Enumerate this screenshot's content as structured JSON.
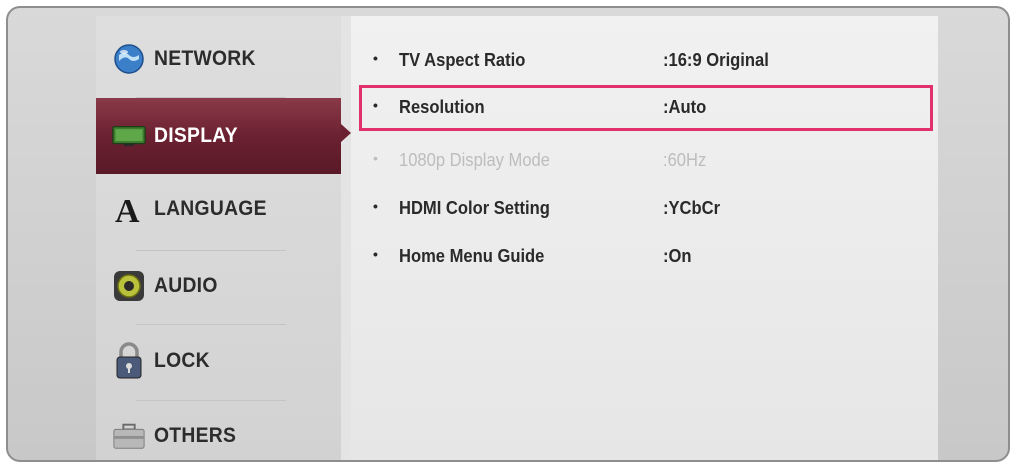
{
  "sidebar": {
    "items": [
      {
        "label": "NETWORK",
        "icon": "globe-icon"
      },
      {
        "label": "DISPLAY",
        "icon": "tv-icon"
      },
      {
        "label": "LANGUAGE",
        "icon": "letter-a-icon"
      },
      {
        "label": "AUDIO",
        "icon": "speaker-icon"
      },
      {
        "label": "LOCK",
        "icon": "padlock-icon"
      },
      {
        "label": "OTHERS",
        "icon": "toolbox-icon"
      }
    ],
    "active": "DISPLAY",
    "active_color": "#6b2131"
  },
  "settings": {
    "rows": [
      {
        "bullet": "•",
        "name": "TV Aspect Ratio",
        "value": ":16:9 Original"
      },
      {
        "bullet": "•",
        "name": "Resolution",
        "value": ":Auto"
      },
      {
        "bullet": "•",
        "name": "1080p Display Mode",
        "value": ":60Hz"
      },
      {
        "bullet": "•",
        "name": "HDMI Color Setting",
        "value": ":YCbCr"
      },
      {
        "bullet": "•",
        "name": "Home Menu Guide",
        "value": ":On"
      }
    ],
    "selected": "Resolution",
    "selection_color": "#e0306e"
  }
}
